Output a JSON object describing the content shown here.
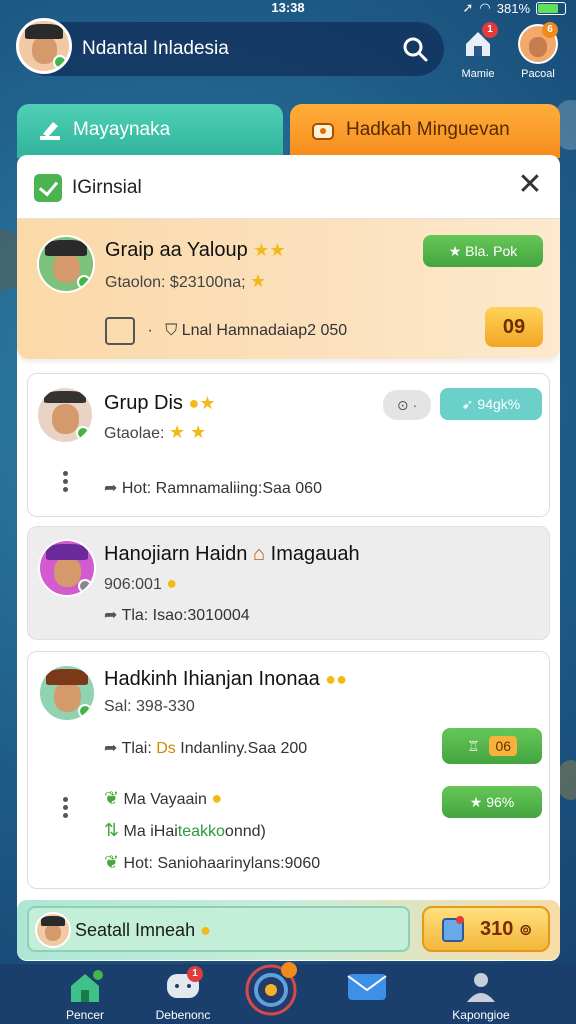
{
  "status": {
    "time": "13:38",
    "battery": "381%"
  },
  "header": {
    "title": "Ndantal Inladesia",
    "icons": [
      {
        "name": "house-icon",
        "label": "Mamie",
        "badge": "1"
      },
      {
        "name": "profile-icon",
        "label": "Pacoal",
        "badge": "6"
      }
    ]
  },
  "tabs": [
    {
      "label": "Mayaynaka",
      "color": "#3cc0a6"
    },
    {
      "label": "Hadkah Minguevan",
      "color": "#f7961f"
    }
  ],
  "panel": {
    "title": "IGirnsial",
    "cards": [
      {
        "name": "Graip aa Yaloup",
        "sub": "Gtaolon: $23100na;",
        "meta": "Lnal Hamnadaiap2 050",
        "badge": "Bla. Pok",
        "score": "09"
      },
      {
        "name": "Grup Dis",
        "sub": "Gtaolae:",
        "meta": "Hot: Ramnamaliing:Saa 060",
        "chip": "⊙ ·",
        "badge": "94gk%"
      },
      {
        "name": "Hanojiarn Haidn",
        "name_suffix": "Imagauah",
        "sub": "906:001",
        "meta": "Tla: Isao:3010004"
      },
      {
        "name": "Hadkinh Ihianjan Inonaa",
        "sub": "Sal: 398-330",
        "meta_prefix": "Tlai:",
        "meta_highlight": "Ds",
        "meta": "Indanliny.Saa 200",
        "score": "06",
        "lines": [
          {
            "text": "Ma Vayaain",
            "icon": "leaf-icon"
          },
          {
            "text_prefix": "Ma iHai",
            "text_highlight": "teakko",
            "text": "onnd)",
            "icon": "arrows-icon"
          },
          {
            "text": "Hot: Saniohaarinylans:9060",
            "icon": "leaf-icon"
          }
        ],
        "badge": "96%"
      }
    ]
  },
  "summary": {
    "label": "Seatall Imneah",
    "coins": "310"
  },
  "bottom_nav": [
    {
      "label": "Pencer",
      "icon": "home-icon",
      "badge": ""
    },
    {
      "label": "Debenonc",
      "icon": "chat-icon",
      "badge": "1"
    },
    {
      "label": "",
      "icon": "target-icon",
      "badge": ""
    },
    {
      "label": "",
      "icon": "mail-icon",
      "badge": ""
    },
    {
      "label": "Kapongioe",
      "icon": "person-icon",
      "badge": ""
    }
  ]
}
